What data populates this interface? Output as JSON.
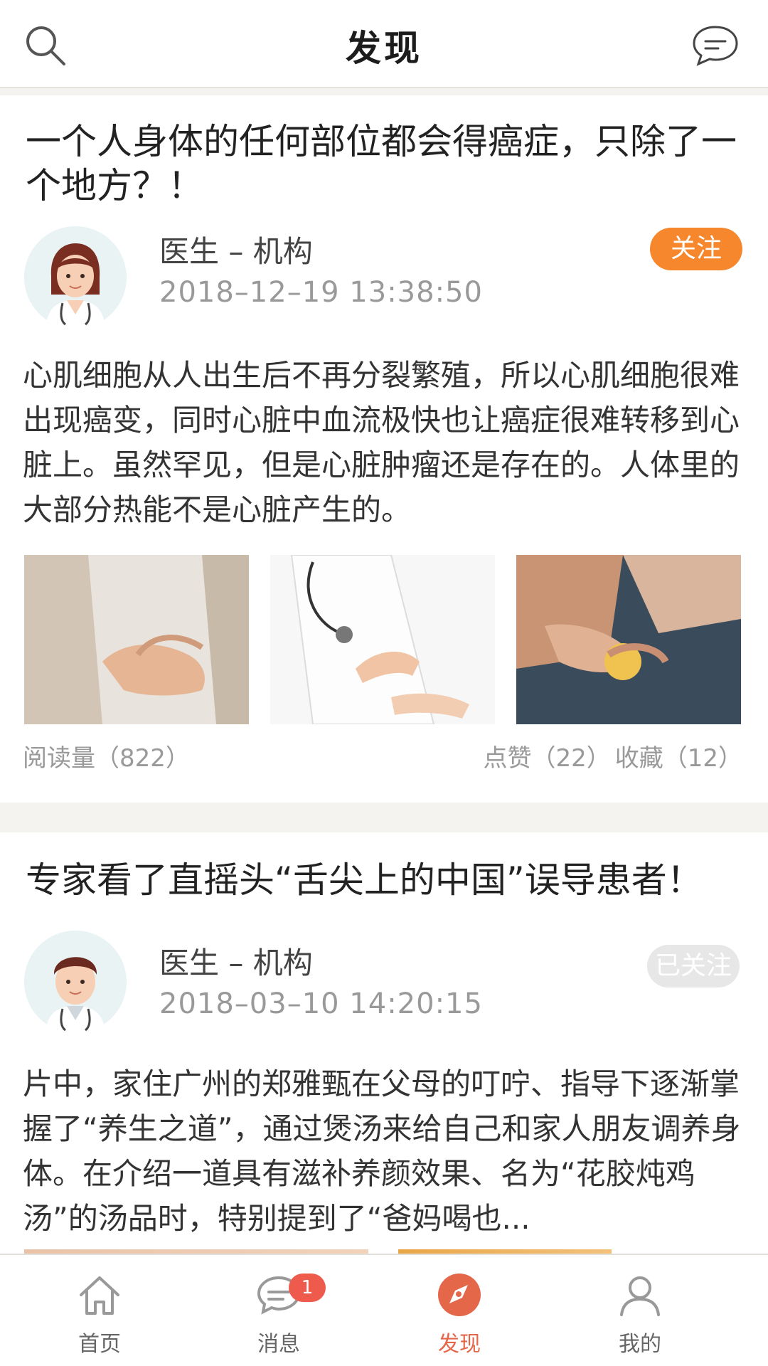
{
  "header": {
    "title": "发现",
    "search_icon": "search-icon",
    "message_icon": "chat-bubble-icon"
  },
  "feed": [
    {
      "headline": "一个人身体的任何部位都会得癌症，只除了一个地方？！",
      "author": "医生 – 机构",
      "time": "2018–12–19 13:38:50",
      "follow_label": "关注",
      "body": "心肌细胞从人出生后不再分裂繁殖，所以心肌细胞很难出现癌变，同时心脏中血流极快也让癌症很难转移到心脏上。虽然罕见，但是心脏肿瘤还是存在的。人体里的大部分热能不是心脏产生的。",
      "reads": "阅读量（822）",
      "likes": "点赞（22）",
      "favorites": "收藏（12）"
    },
    {
      "headline": "专家看了直摇头“舌尖上的中国”误导患者！",
      "author": "医生 – 机构",
      "time": "2018–03–10  14:20:15",
      "follow_label": "已关注",
      "body": "片中，家住广州的郑雅甄在父母的叮咛、指导下逐渐掌握了“养生之道”，通过煲汤来给自己和家人朋友调养身体。在介绍一道具有滋补养颜效果、名为“花胶炖鸡汤”的汤品时，特别提到了“爸妈喝也..."
    }
  ],
  "tabbar": {
    "items": [
      {
        "label": "首页",
        "icon": "home-icon"
      },
      {
        "label": "消息",
        "icon": "message-icon",
        "badge": "1"
      },
      {
        "label": "发现",
        "icon": "discover-compass-icon"
      },
      {
        "label": "我的",
        "icon": "profile-icon"
      }
    ]
  },
  "colors": {
    "accent": "#e4674a",
    "follow_button": "#f6872c",
    "followed_button": "#e7e7e7",
    "badge": "#ee5a4b"
  }
}
